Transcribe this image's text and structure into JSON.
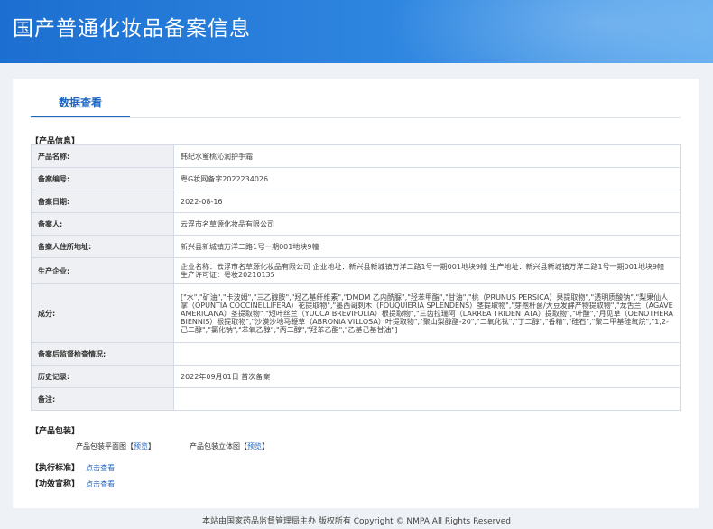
{
  "header": {
    "title": "国产普通化妆品备案信息"
  },
  "tab": {
    "label": "数据查看"
  },
  "sections": {
    "product_info": "【产品信息】",
    "packaging": "【产品包装】",
    "standard": "【执行标准】",
    "efficacy": "【功效宣称】"
  },
  "rows": [
    {
      "label": "产品名称:",
      "value": "韩纪水蜜桃沁润护手霜"
    },
    {
      "label": "备案编号:",
      "value": "粤G妆网备字2022234026"
    },
    {
      "label": "备案日期:",
      "value": "2022-08-16"
    },
    {
      "label": "备案人:",
      "value": "云浮市名草源化妆品有限公司"
    },
    {
      "label": "备案人住所地址:",
      "value": "新兴县新城镇万洋二路1号一期001地块9幢"
    },
    {
      "label": "生产企业:",
      "value": "企业名称：云浮市名草源化妆品有限公司 企业地址：新兴县新城镇万洋二路1号一期001地块9幢 生产地址：新兴县新城镇万洋二路1号一期001地块9幢 生产许可证：粤妆20210135"
    },
    {
      "label": "成分:",
      "value": "[\"水\",\"矿油\",\"卡波姆\",\"三乙醇胺\",\"羟乙基纤维素\",\"DMDM 乙内酰脲\",\"羟苯甲酯\",\"甘油\",\"桃（PRUNUS PERSICA）果提取物\",\"透明质酸钠\",\"梨果仙人掌（OPUNTIA COCCINELLIFERA）花提取物\",\"墨西哥刺木（FOUQUIERIA SPLENDENS）茎提取物\",\"芽孢杆菌/大豆发酵产物提取物\",\"龙舌兰（AGAVE AMERICANA）茎提取物\",\"短叶丝兰（YUCCA BREVIFOLIA）根提取物\",\"三齿拉瑞阿（LARREA TRIDENTATA）提取物\",\"叶酸\",\"月见草（OENOTHERA BIENNIS）根提取物\",\"沙漠沙地马鞭草（ABRONIA VILLOSA）叶提取物\",\"聚山梨醇酯-20\",\"二氧化钛\",\"丁二醇\",\"香精\",\"硅石\",\"聚二甲基硅氧烷\",\"1,2-己二醇\",\"氯化钠\",\"苯氧乙醇\",\"丙二醇\",\"羟苯乙酯\",\"乙基己基甘油\"]"
    },
    {
      "label": "备案后监督检查情况:",
      "value": ""
    },
    {
      "label": "历史记录:",
      "value": "2022年09月01日 首次备案"
    },
    {
      "label": "备注:",
      "value": ""
    }
  ],
  "packaging": {
    "flat_label": "产品包装平面图",
    "stereo_label": "产品包装立体图",
    "preview_link": "预览",
    "bracket_open": "【",
    "bracket_close": "】"
  },
  "standard": {
    "link": "点击查看"
  },
  "efficacy": {
    "link": "点击查看"
  },
  "footer": {
    "text": "本站由国家药品监督管理局主办 版权所有 Copyright © NMPA All Rights Reserved"
  },
  "colors": {
    "header_start": "#1c6fd0",
    "header_end": "#64aef0",
    "accent": "#1f66c1",
    "label_bg": "#eef0f3"
  }
}
